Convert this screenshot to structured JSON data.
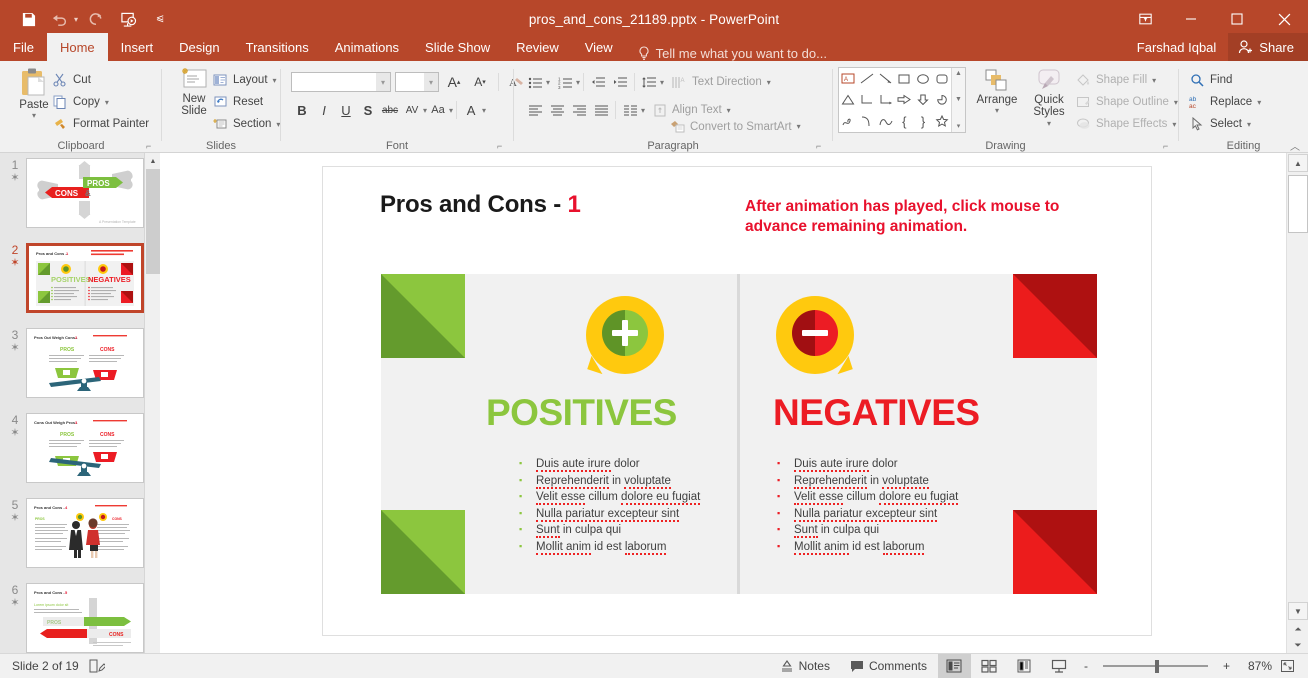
{
  "window": {
    "title": "pros_and_cons_21189.pptx - PowerPoint",
    "user": "Farshad Iqbal",
    "share_label": "Share",
    "ribbon_display_icon": "ribbon-display-options-icon",
    "minimize_icon": "minimize-icon",
    "maximize_icon": "maximize-icon",
    "close_icon": "close-icon"
  },
  "quick_access": {
    "save_icon": "save-icon",
    "undo_icon": "undo-icon",
    "redo_icon": "redo-icon",
    "start_presentation_icon": "start-from-beginning-icon",
    "customize_icon": "customize-quick-access-toolbar-icon"
  },
  "tabs": [
    {
      "label": "File",
      "active": false
    },
    {
      "label": "Home",
      "active": true
    },
    {
      "label": "Insert",
      "active": false
    },
    {
      "label": "Design",
      "active": false
    },
    {
      "label": "Transitions",
      "active": false
    },
    {
      "label": "Animations",
      "active": false
    },
    {
      "label": "Slide Show",
      "active": false
    },
    {
      "label": "Review",
      "active": false
    },
    {
      "label": "View",
      "active": false
    }
  ],
  "tell_me": {
    "placeholder": "Tell me what you want to do...",
    "icon": "lightbulb-icon"
  },
  "ribbon": {
    "clipboard": {
      "label": "Clipboard",
      "paste": "Paste",
      "cut": "Cut",
      "copy": "Copy",
      "format_painter": "Format Painter"
    },
    "slides": {
      "label": "Slides",
      "new_slide": "New\nSlide",
      "new_slide_line1": "New",
      "new_slide_line2": "Slide",
      "layout": "Layout",
      "reset": "Reset",
      "section": "Section"
    },
    "font": {
      "label": "Font",
      "font_name_value": "",
      "font_size_value": "",
      "grow_font": "A",
      "shrink_font": "A",
      "clear_formatting_icon": "clear-formatting-icon",
      "bold": "B",
      "italic": "I",
      "underline": "U",
      "shadow": "S",
      "strikethrough": "abc",
      "character_spacing": "AV",
      "change_case": "Aa",
      "font_color": "A"
    },
    "paragraph": {
      "label": "Paragraph",
      "text_direction": "Text Direction",
      "align_text": "Align Text",
      "convert_to_smartart": "Convert to SmartArt"
    },
    "drawing": {
      "label": "Drawing",
      "arrange": "Arrange",
      "quick_styles_line1": "Quick",
      "quick_styles_line2": "Styles",
      "shape_fill": "Shape Fill",
      "shape_outline": "Shape Outline",
      "shape_effects": "Shape Effects"
    },
    "editing": {
      "label": "Editing",
      "find": "Find",
      "replace": "Replace",
      "select": "Select",
      "collapse_ribbon_icon": "collapse-ribbon-icon"
    }
  },
  "thumbnails": [
    {
      "number": "1",
      "selected": false,
      "kind": "cons-pros-thumbs",
      "title": "",
      "label_left": "CONS",
      "label_amp": "&",
      "label_right": "PROS",
      "footer": "A Presentation Template"
    },
    {
      "number": "2",
      "selected": true,
      "kind": "pros-cons-panels",
      "title": "Pros and Cons -  1"
    },
    {
      "number": "3",
      "selected": false,
      "kind": "scale",
      "title": "Pros Out Weigh Cons -  2",
      "left": "PROS",
      "right": "CONS"
    },
    {
      "number": "4",
      "selected": false,
      "kind": "scale",
      "title": "Cons Out Weigh Pros -  3",
      "left": "PROS",
      "right": "CONS"
    },
    {
      "number": "5",
      "selected": false,
      "kind": "people",
      "title": "Pros and Cons -  4"
    },
    {
      "number": "6",
      "selected": false,
      "kind": "arrows",
      "title": "Pros and Cons -  5",
      "left": "PROS",
      "right": "CONS"
    }
  ],
  "slide": {
    "title_text": "Pros and Cons - ",
    "title_number": "1",
    "note": "After animation has played, click mouse to advance remaining animation.",
    "positives": {
      "heading": "POSITIVES",
      "icon": "plus-speech-bubble-icon",
      "bullets": [
        {
          "misspelled": "Duis aute irure",
          "rest": " dolor"
        },
        {
          "misspelled": "Reprehenderit",
          "rest": " in ",
          "misspelled2": "voluptate"
        },
        {
          "misspelled": "Velit esse",
          "rest": " cillum ",
          "misspelled2": "dolore eu fugiat"
        },
        {
          "misspelled": "Nulla pariatur excepteur sint",
          "rest": ""
        },
        {
          "misspelled": "Sunt",
          "rest": " in culpa qui"
        },
        {
          "misspelled": "Mollit anim",
          "rest": " id est ",
          "misspelled2": "laborum"
        }
      ]
    },
    "negatives": {
      "heading": "NEGATIVES",
      "icon": "minus-speech-bubble-icon",
      "bullets": [
        {
          "misspelled": "Duis aute irure",
          "rest": " dolor"
        },
        {
          "misspelled": "Reprehenderit",
          "rest": " in ",
          "misspelled2": "voluptate"
        },
        {
          "misspelled": "Velit esse",
          "rest": " cillum ",
          "misspelled2": "dolore eu fugiat"
        },
        {
          "misspelled": "Nulla pariatur excepteur sint",
          "rest": ""
        },
        {
          "misspelled": "Sunt",
          "rest": " in culpa qui"
        },
        {
          "misspelled": "Mollit anim",
          "rest": " id est ",
          "misspelled2": "laborum"
        }
      ]
    }
  },
  "status": {
    "slide_counter": "Slide 2 of 19",
    "notes_icon_label": "slide-notes-icon",
    "notes": "Notes",
    "comments": "Comments",
    "zoom_percent": "87%",
    "zoom_out": "-",
    "zoom_in": "+",
    "view_normal_icon": "normal-view-icon",
    "view_sorter_icon": "slide-sorter-icon",
    "view_reading_icon": "reading-view-icon",
    "view_slideshow_icon": "slide-show-icon",
    "fit_slide_icon": "fit-slide-to-window-icon"
  },
  "colors": {
    "accent": "#b7472a",
    "green": "#8cc63e",
    "green_dark": "#649b2d",
    "red": "#ec1c24",
    "red_dark": "#ae1111",
    "yellow": "#ffc90e"
  }
}
